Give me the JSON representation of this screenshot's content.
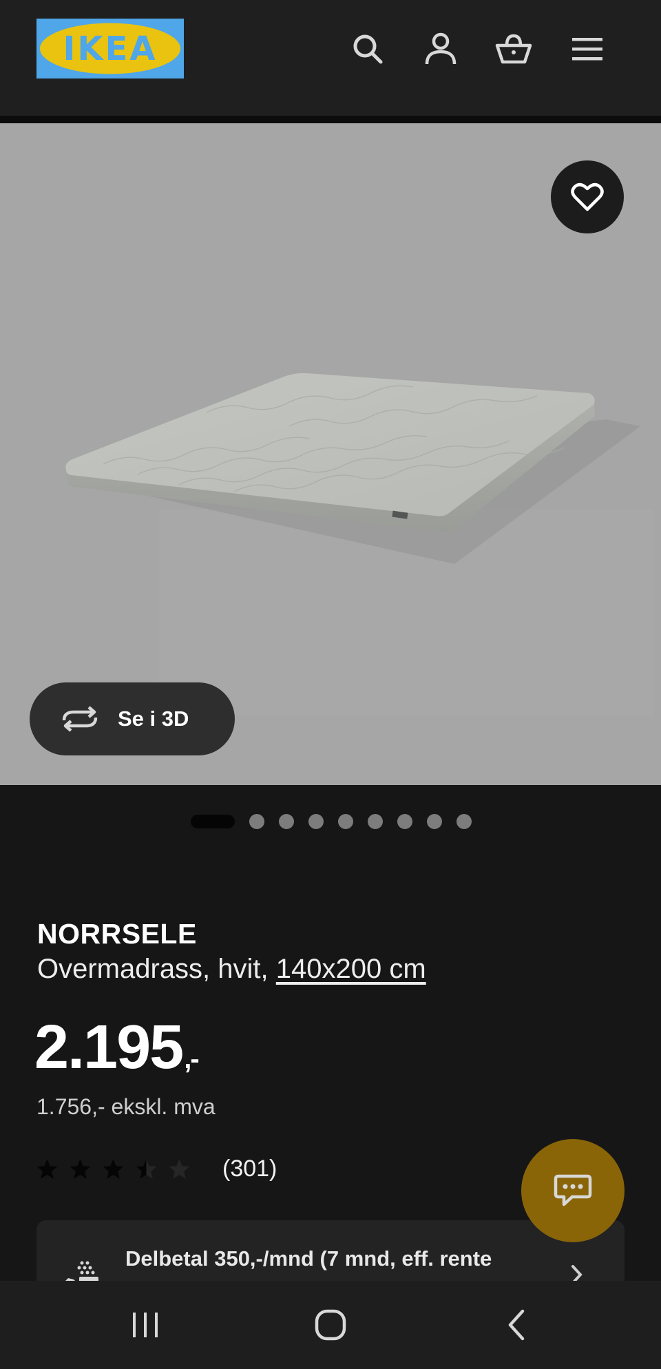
{
  "header": {
    "logo_text": "IKEA",
    "icons": [
      "search-icon",
      "user-icon",
      "basket-icon",
      "menu-icon"
    ]
  },
  "hero": {
    "favorite_icon": "heart-icon",
    "view_3d_label": "Se i 3D",
    "view_3d_icon": "rotate-3d-icon",
    "image_count": 9,
    "active_image": 1
  },
  "product": {
    "name": "NORRSELE",
    "description": "Overmadrass, hvit, ",
    "size": "140x200 cm",
    "price_main": "2.195",
    "price_suffix": ",-",
    "price_ex_vat": "1.756,- ekskl. mva",
    "rating_value": 3.5,
    "rating_max": 5,
    "rating_count": "(301)"
  },
  "installment": {
    "text": "Delbetal 350,-/mnd (7 mnd, eff. rente",
    "icon": "payment-icon"
  },
  "chat": {
    "icon": "chat-icon"
  },
  "colors": {
    "header_bg": "#1f1f20",
    "page_bg": "#161617",
    "hero_bg": "#a6a6a6",
    "logo_blue": "#4fa6e8",
    "logo_yellow": "#e9c310",
    "chat_bg": "#8a6508"
  },
  "system_nav": [
    "recent-apps-icon",
    "home-icon",
    "back-icon"
  ]
}
